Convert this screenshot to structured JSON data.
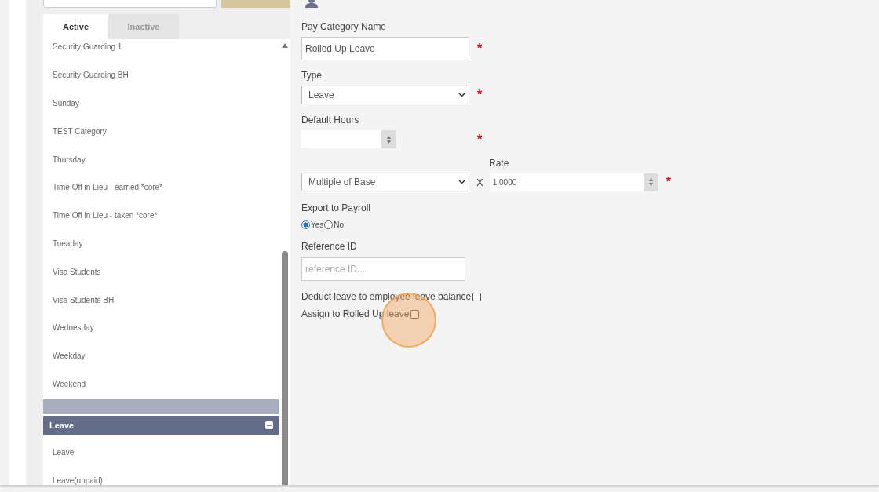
{
  "tabs": [
    {
      "label": "Active",
      "selected": true
    },
    {
      "label": "Inactive",
      "selected": false
    }
  ],
  "list": {
    "rows": [
      {
        "kind": "item",
        "label": "Security Guarding 1"
      },
      {
        "kind": "item",
        "label": "Security Guarding BH"
      },
      {
        "kind": "item",
        "label": "Sunday"
      },
      {
        "kind": "item",
        "label": "TEST Category"
      },
      {
        "kind": "item",
        "label": "Thursday"
      },
      {
        "kind": "item",
        "label": "Time Off in Lieu - earned *core*"
      },
      {
        "kind": "item",
        "label": "Time Off in Lieu - taken *core*"
      },
      {
        "kind": "item",
        "label": "Tueaday"
      },
      {
        "kind": "item",
        "label": "Visa Students"
      },
      {
        "kind": "item",
        "label": "Visa Students BH"
      },
      {
        "kind": "item",
        "label": "Wednesday"
      },
      {
        "kind": "item",
        "label": "Weekday"
      },
      {
        "kind": "item",
        "label": "Weekend"
      },
      {
        "kind": "blank-header"
      },
      {
        "kind": "group",
        "label": "Leave",
        "expanded": true
      },
      {
        "kind": "item",
        "label": "Leave"
      },
      {
        "kind": "item",
        "label": "Leave(unpaid)"
      }
    ]
  },
  "form": {
    "name": {
      "label": "Pay Category Name",
      "value": "Rolled Up Leave",
      "required_mark": "*"
    },
    "type": {
      "label": "Type",
      "value": "Leave",
      "required_mark": "*"
    },
    "default_hours": {
      "label": "Default Hours",
      "required_mark": "*"
    },
    "rate": {
      "basis": "Multiple of Base",
      "operator": "X",
      "label": "Rate",
      "value": "1.0000",
      "required_mark": "*"
    },
    "export": {
      "label": "Export to Payroll",
      "options": [
        {
          "label": "Yes",
          "selected": true
        },
        {
          "label": "No",
          "selected": false
        }
      ]
    },
    "reference": {
      "label": "Reference ID",
      "placeholder": "reference ID..."
    },
    "checkboxes": [
      {
        "label": "Deduct leave to employee leave balance",
        "checked": false
      },
      {
        "label": "Assign to Rolled Up leave",
        "checked": false
      }
    ]
  }
}
